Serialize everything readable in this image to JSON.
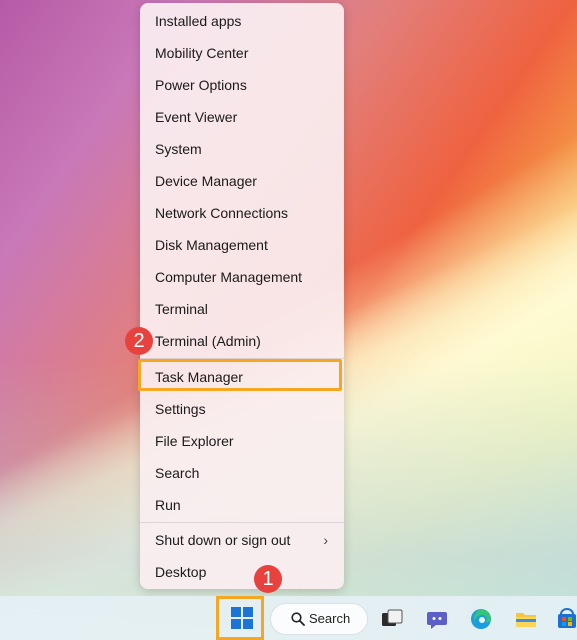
{
  "menu": {
    "items": [
      {
        "label": "Installed apps"
      },
      {
        "label": "Mobility Center"
      },
      {
        "label": "Power Options"
      },
      {
        "label": "Event Viewer"
      },
      {
        "label": "System"
      },
      {
        "label": "Device Manager"
      },
      {
        "label": "Network Connections"
      },
      {
        "label": "Disk Management"
      },
      {
        "label": "Computer Management"
      },
      {
        "label": "Terminal"
      },
      {
        "label": "Terminal (Admin)"
      },
      {
        "label": "Task Manager"
      },
      {
        "label": "Settings"
      },
      {
        "label": "File Explorer"
      },
      {
        "label": "Search"
      },
      {
        "label": "Run"
      },
      {
        "label": "Shut down or sign out",
        "chevron": "›"
      },
      {
        "label": "Desktop"
      }
    ],
    "highlighted": "Task Manager"
  },
  "badges": {
    "step1": "1",
    "step2": "2"
  },
  "taskbar": {
    "search_label": "Search",
    "icons": [
      "start-icon",
      "search-icon",
      "task-view-icon",
      "chat-icon",
      "edge-icon",
      "file-explorer-icon",
      "store-icon"
    ]
  },
  "colors": {
    "highlight": "#f5a623",
    "badge": "#e8423f",
    "start_blue": "#1b74d6"
  }
}
